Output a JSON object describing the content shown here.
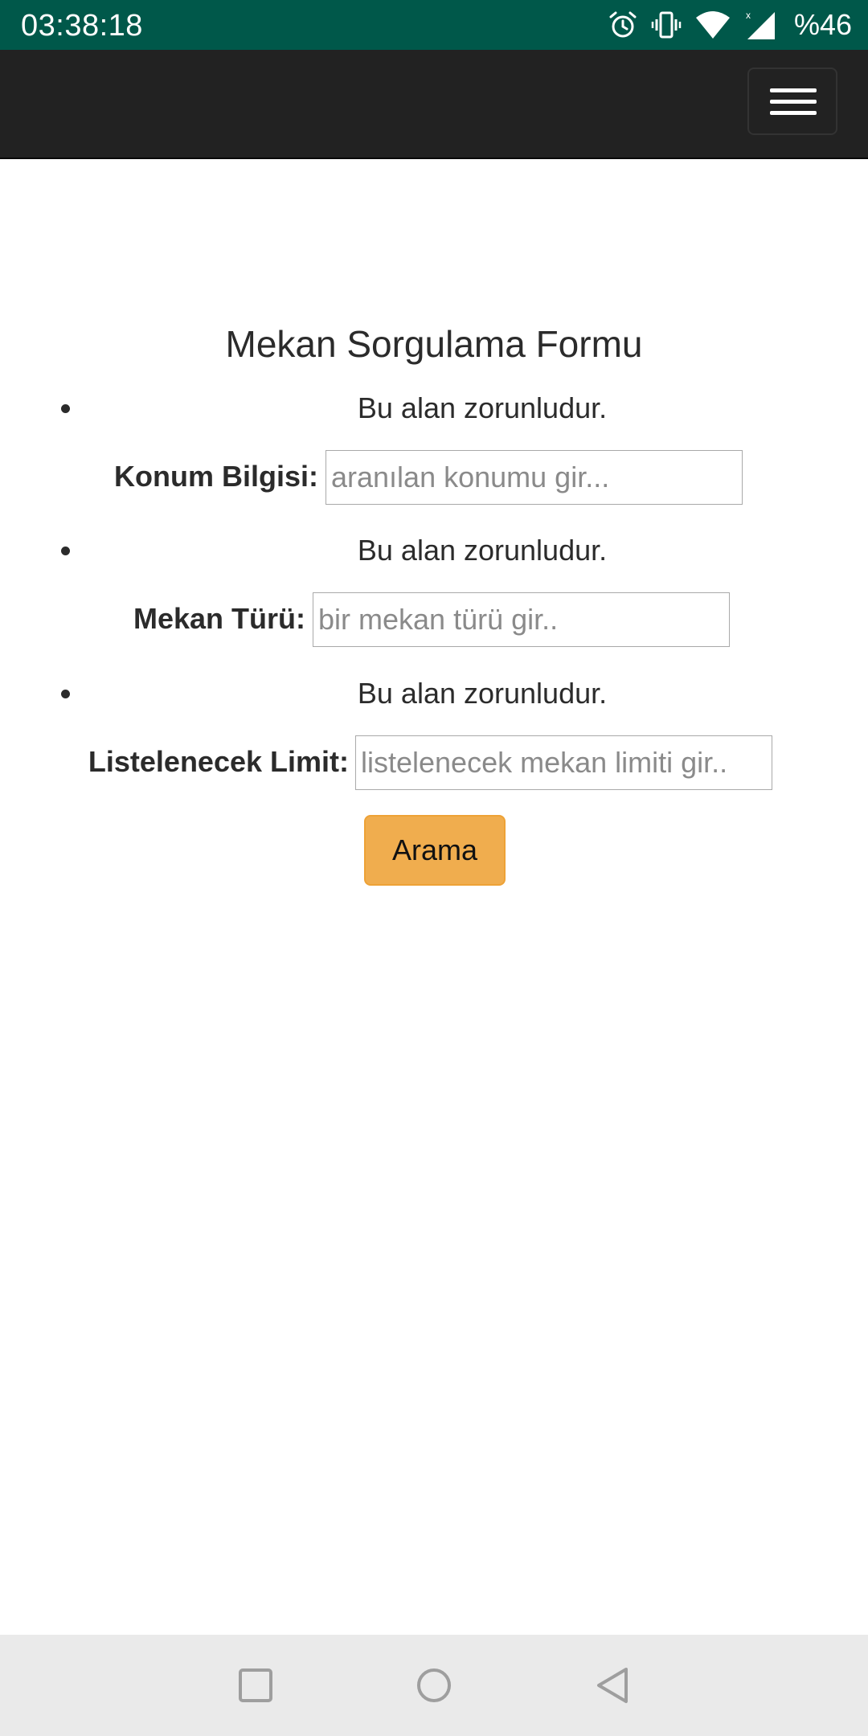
{
  "status_bar": {
    "time": "03:38:18",
    "battery": "%46",
    "icons": [
      "alarm-icon",
      "vibrate-icon",
      "wifi-icon",
      "signal-icon"
    ],
    "background": "#00584a"
  },
  "navbar": {
    "background": "#222222",
    "menu_icon": "hamburger-menu-icon"
  },
  "form": {
    "title": "Mekan Sorgulama Formu",
    "fields": [
      {
        "error": "Bu alan zorunludur.",
        "label": "Konum Bilgisi:",
        "placeholder": "aranılan konumu gir..."
      },
      {
        "error": "Bu alan zorunludur.",
        "label": "Mekan Türü:",
        "placeholder": "bir mekan türü gir.."
      },
      {
        "error": "Bu alan zorunludur.",
        "label": "Listelenecek Limit:",
        "placeholder": "listelenecek mekan limiti gir.."
      }
    ],
    "submit_label": "Arama",
    "submit_color": "#f0ad4e"
  },
  "system_nav": {
    "buttons": [
      "recents-icon",
      "home-icon",
      "back-icon"
    ]
  }
}
